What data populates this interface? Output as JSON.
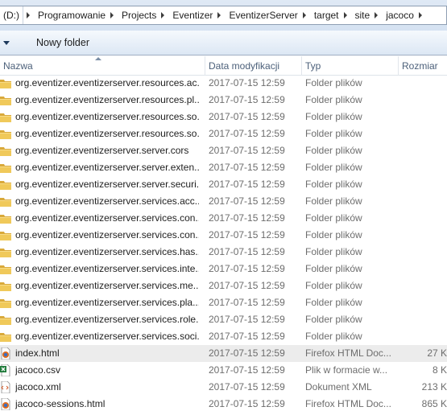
{
  "address": {
    "drive": "(D:)",
    "crumbs": [
      "Programowanie",
      "Projects",
      "Eventizer",
      "EventizerServer",
      "target",
      "site",
      "jacoco"
    ]
  },
  "toolbar": {
    "new_folder_label": "Nowy folder"
  },
  "columns": {
    "name": "Nazwa",
    "date": "Data modyfikacji",
    "type": "Typ",
    "size": "Rozmiar"
  },
  "files": [
    {
      "name": "org.eventizer.eventizerserver.resources.ac...",
      "date": "2017-07-15 12:59",
      "type": "Folder plików",
      "size": "",
      "icon": "folder-icon"
    },
    {
      "name": "org.eventizer.eventizerserver.resources.pl...",
      "date": "2017-07-15 12:59",
      "type": "Folder plików",
      "size": "",
      "icon": "folder-icon"
    },
    {
      "name": "org.eventizer.eventizerserver.resources.so...",
      "date": "2017-07-15 12:59",
      "type": "Folder plików",
      "size": "",
      "icon": "folder-icon"
    },
    {
      "name": "org.eventizer.eventizerserver.resources.so...",
      "date": "2017-07-15 12:59",
      "type": "Folder plików",
      "size": "",
      "icon": "folder-icon"
    },
    {
      "name": "org.eventizer.eventizerserver.server.cors",
      "date": "2017-07-15 12:59",
      "type": "Folder plików",
      "size": "",
      "icon": "folder-icon"
    },
    {
      "name": "org.eventizer.eventizerserver.server.exten...",
      "date": "2017-07-15 12:59",
      "type": "Folder plików",
      "size": "",
      "icon": "folder-icon"
    },
    {
      "name": "org.eventizer.eventizerserver.server.securi...",
      "date": "2017-07-15 12:59",
      "type": "Folder plików",
      "size": "",
      "icon": "folder-icon"
    },
    {
      "name": "org.eventizer.eventizerserver.services.acc...",
      "date": "2017-07-15 12:59",
      "type": "Folder plików",
      "size": "",
      "icon": "folder-icon"
    },
    {
      "name": "org.eventizer.eventizerserver.services.con...",
      "date": "2017-07-15 12:59",
      "type": "Folder plików",
      "size": "",
      "icon": "folder-icon"
    },
    {
      "name": "org.eventizer.eventizerserver.services.con...",
      "date": "2017-07-15 12:59",
      "type": "Folder plików",
      "size": "",
      "icon": "folder-icon"
    },
    {
      "name": "org.eventizer.eventizerserver.services.has...",
      "date": "2017-07-15 12:59",
      "type": "Folder plików",
      "size": "",
      "icon": "folder-icon"
    },
    {
      "name": "org.eventizer.eventizerserver.services.inte...",
      "date": "2017-07-15 12:59",
      "type": "Folder plików",
      "size": "",
      "icon": "folder-icon"
    },
    {
      "name": "org.eventizer.eventizerserver.services.me...",
      "date": "2017-07-15 12:59",
      "type": "Folder plików",
      "size": "",
      "icon": "folder-icon"
    },
    {
      "name": "org.eventizer.eventizerserver.services.pla...",
      "date": "2017-07-15 12:59",
      "type": "Folder plików",
      "size": "",
      "icon": "folder-icon"
    },
    {
      "name": "org.eventizer.eventizerserver.services.role...",
      "date": "2017-07-15 12:59",
      "type": "Folder plików",
      "size": "",
      "icon": "folder-icon"
    },
    {
      "name": "org.eventizer.eventizerserver.services.soci...",
      "date": "2017-07-15 12:59",
      "type": "Folder plików",
      "size": "",
      "icon": "folder-icon"
    },
    {
      "name": "index.html",
      "date": "2017-07-15 12:59",
      "type": "Firefox HTML Doc...",
      "size": "27 K",
      "icon": "firefox-html-icon",
      "selected": true
    },
    {
      "name": "jacoco.csv",
      "date": "2017-07-15 12:59",
      "type": "Plik w formacie w...",
      "size": "8 K",
      "icon": "excel-csv-icon"
    },
    {
      "name": "jacoco.xml",
      "date": "2017-07-15 12:59",
      "type": "Dokument XML",
      "size": "213 K",
      "icon": "xml-document-icon"
    },
    {
      "name": "jacoco-sessions.html",
      "date": "2017-07-15 12:59",
      "type": "Firefox HTML Doc...",
      "size": "865 K",
      "icon": "firefox-html-icon"
    }
  ],
  "colors": {
    "folder": "#e8c04f",
    "selection": "#ececec",
    "header_text": "#4c607a"
  }
}
